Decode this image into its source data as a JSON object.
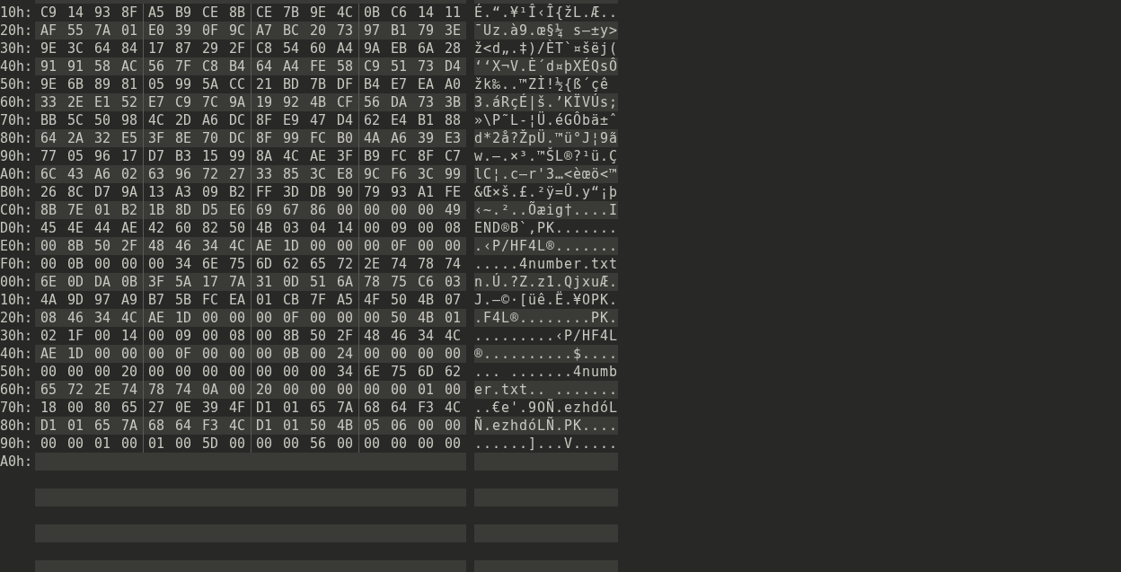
{
  "rows": [
    {
      "offset": "10h:",
      "bytes": [
        "C9",
        "14",
        "93",
        "8F",
        "A5",
        "B9",
        "CE",
        "8B",
        "CE",
        "7B",
        "9E",
        "4C",
        "0B",
        "C6",
        "14",
        "11"
      ],
      "ascii": "É.“.¥¹Î‹Î{žL.Æ.."
    },
    {
      "offset": "20h:",
      "bytes": [
        "AF",
        "55",
        "7A",
        "01",
        "E0",
        "39",
        "0F",
        "9C",
        "A7",
        "BC",
        "20",
        "73",
        "97",
        "B1",
        "79",
        "3E"
      ],
      "ascii": "¯Uz.à9.œ§¼ s—±y>"
    },
    {
      "offset": "30h:",
      "bytes": [
        "9E",
        "3C",
        "64",
        "84",
        "17",
        "87",
        "29",
        "2F",
        "C8",
        "54",
        "60",
        "A4",
        "9A",
        "EB",
        "6A",
        "28"
      ],
      "ascii": "ž<d„.‡)/ÈT`¤šëj("
    },
    {
      "offset": "40h:",
      "bytes": [
        "91",
        "91",
        "58",
        "AC",
        "56",
        "7F",
        "C8",
        "B4",
        "64",
        "A4",
        "FE",
        "58",
        "C9",
        "51",
        "73",
        "D4"
      ],
      "ascii": "‘‘X¬V.È´d¤þXÉQsÔ"
    },
    {
      "offset": "50h:",
      "bytes": [
        "9E",
        "6B",
        "89",
        "81",
        "05",
        "99",
        "5A",
        "CC",
        "21",
        "BD",
        "7B",
        "DF",
        "B4",
        "E7",
        "EA",
        "A0"
      ],
      "ascii": "žk‰..™ZÌ!½{ß´çê"
    },
    {
      "offset": "60h:",
      "bytes": [
        "33",
        "2E",
        "E1",
        "52",
        "E7",
        "C9",
        "7C",
        "9A",
        "19",
        "92",
        "4B",
        "CF",
        "56",
        "DA",
        "73",
        "3B"
      ],
      "ascii": "3.áRçÉ|š.’KÏVÚs;"
    },
    {
      "offset": "70h:",
      "bytes": [
        "BB",
        "5C",
        "50",
        "98",
        "4C",
        "2D",
        "A6",
        "DC",
        "8F",
        "E9",
        "47",
        "D4",
        "62",
        "E4",
        "B1",
        "88"
      ],
      "ascii": "»\\P˜L-¦Ü.éGÔbä±ˆ"
    },
    {
      "offset": "80h:",
      "bytes": [
        "64",
        "2A",
        "32",
        "E5",
        "3F",
        "8E",
        "70",
        "DC",
        "8F",
        "99",
        "FC",
        "B0",
        "4A",
        "A6",
        "39",
        "E3"
      ],
      "ascii": "d*2å?ŽpÜ.™ü°J¦9ã"
    },
    {
      "offset": "90h:",
      "bytes": [
        "77",
        "05",
        "96",
        "17",
        "D7",
        "B3",
        "15",
        "99",
        "8A",
        "4C",
        "AE",
        "3F",
        "B9",
        "FC",
        "8F",
        "C7"
      ],
      "ascii": "w.–.×³.™ŠL®?¹ü.Ç"
    },
    {
      "offset": "A0h:",
      "bytes": [
        "6C",
        "43",
        "A6",
        "02",
        "63",
        "96",
        "72",
        "27",
        "33",
        "85",
        "3C",
        "E8",
        "9C",
        "F6",
        "3C",
        "99"
      ],
      "ascii": "lC¦.c–r'3…<èœö<™"
    },
    {
      "offset": "B0h:",
      "bytes": [
        "26",
        "8C",
        "D7",
        "9A",
        "13",
        "A3",
        "09",
        "B2",
        "FF",
        "3D",
        "DB",
        "90",
        "79",
        "93",
        "A1",
        "FE"
      ],
      "ascii": "&Œ×š.£.²ÿ=Û.y“¡þ"
    },
    {
      "offset": "C0h:",
      "bytes": [
        "8B",
        "7E",
        "01",
        "B2",
        "1B",
        "8D",
        "D5",
        "E6",
        "69",
        "67",
        "86",
        "00",
        "00",
        "00",
        "00",
        "49"
      ],
      "ascii": "‹~.²..Õæig†....I"
    },
    {
      "offset": "D0h:",
      "bytes": [
        "45",
        "4E",
        "44",
        "AE",
        "42",
        "60",
        "82",
        "50",
        "4B",
        "03",
        "04",
        "14",
        "00",
        "09",
        "00",
        "08"
      ],
      "ascii": "END®B`‚PK......."
    },
    {
      "offset": "E0h:",
      "bytes": [
        "00",
        "8B",
        "50",
        "2F",
        "48",
        "46",
        "34",
        "4C",
        "AE",
        "1D",
        "00",
        "00",
        "00",
        "0F",
        "00",
        "00"
      ],
      "ascii": ".‹P/HF4L®......."
    },
    {
      "offset": "F0h:",
      "bytes": [
        "00",
        "0B",
        "00",
        "00",
        "00",
        "34",
        "6E",
        "75",
        "6D",
        "62",
        "65",
        "72",
        "2E",
        "74",
        "78",
        "74"
      ],
      "ascii": ".....4number.txt"
    },
    {
      "offset": "00h:",
      "bytes": [
        "6E",
        "0D",
        "DA",
        "0B",
        "3F",
        "5A",
        "17",
        "7A",
        "31",
        "0D",
        "51",
        "6A",
        "78",
        "75",
        "C6",
        "03"
      ],
      "ascii": "n.Ú.?Z.z1.QjxuÆ."
    },
    {
      "offset": "10h:",
      "bytes": [
        "4A",
        "9D",
        "97",
        "A9",
        "B7",
        "5B",
        "FC",
        "EA",
        "01",
        "CB",
        "7F",
        "A5",
        "4F",
        "50",
        "4B",
        "07"
      ],
      "ascii": "J.—©·[üê.Ë.¥OPK."
    },
    {
      "offset": "20h:",
      "bytes": [
        "08",
        "46",
        "34",
        "4C",
        "AE",
        "1D",
        "00",
        "00",
        "00",
        "0F",
        "00",
        "00",
        "00",
        "50",
        "4B",
        "01"
      ],
      "ascii": ".F4L®........PK."
    },
    {
      "offset": "30h:",
      "bytes": [
        "02",
        "1F",
        "00",
        "14",
        "00",
        "09",
        "00",
        "08",
        "00",
        "8B",
        "50",
        "2F",
        "48",
        "46",
        "34",
        "4C"
      ],
      "ascii": ".........‹P/HF4L"
    },
    {
      "offset": "40h:",
      "bytes": [
        "AE",
        "1D",
        "00",
        "00",
        "00",
        "0F",
        "00",
        "00",
        "00",
        "0B",
        "00",
        "24",
        "00",
        "00",
        "00",
        "00"
      ],
      "ascii": "®..........$...."
    },
    {
      "offset": "50h:",
      "bytes": [
        "00",
        "00",
        "00",
        "20",
        "00",
        "00",
        "00",
        "00",
        "00",
        "00",
        "00",
        "34",
        "6E",
        "75",
        "6D",
        "62"
      ],
      "ascii": "... .......4numb"
    },
    {
      "offset": "60h:",
      "bytes": [
        "65",
        "72",
        "2E",
        "74",
        "78",
        "74",
        "0A",
        "00",
        "20",
        "00",
        "00",
        "00",
        "00",
        "00",
        "01",
        "00"
      ],
      "ascii": "er.txt.. ......."
    },
    {
      "offset": "70h:",
      "bytes": [
        "18",
        "00",
        "80",
        "65",
        "27",
        "0E",
        "39",
        "4F",
        "D1",
        "01",
        "65",
        "7A",
        "68",
        "64",
        "F3",
        "4C"
      ],
      "ascii": "..€e'.9OÑ.ezhdóL"
    },
    {
      "offset": "80h:",
      "bytes": [
        "D1",
        "01",
        "65",
        "7A",
        "68",
        "64",
        "F3",
        "4C",
        "D1",
        "01",
        "50",
        "4B",
        "05",
        "06",
        "00",
        "00"
      ],
      "ascii": "Ñ.ezhdóLÑ.PK...."
    },
    {
      "offset": "90h:",
      "bytes": [
        "00",
        "00",
        "01",
        "00",
        "01",
        "00",
        "5D",
        "00",
        "00",
        "00",
        "56",
        "00",
        "00",
        "00",
        "00",
        "00"
      ],
      "ascii": "......]...V....."
    },
    {
      "offset": "A0h:"
    }
  ]
}
